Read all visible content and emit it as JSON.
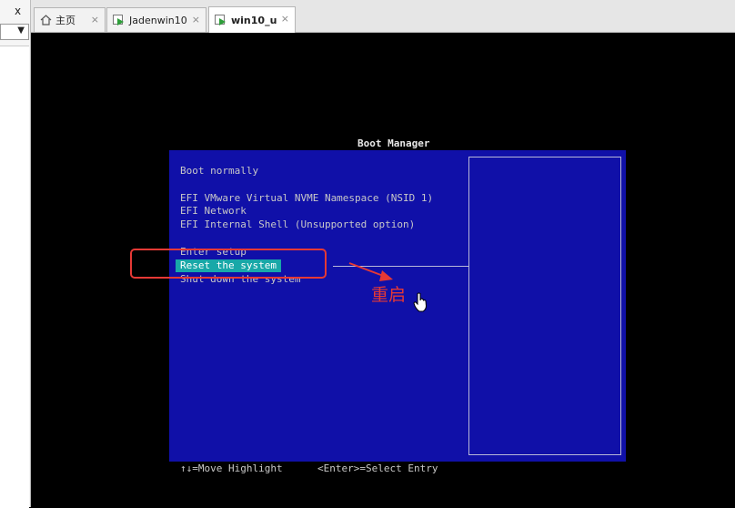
{
  "left_panel": {
    "close_glyph": "x",
    "dropdown_arrow": "▼"
  },
  "tabs": [
    {
      "label": "主页",
      "icon": "home-icon",
      "close": "×",
      "active": false
    },
    {
      "label": "Jadenwin10",
      "icon": "vm-icon",
      "close": "×",
      "active": false
    },
    {
      "label": "win10_u",
      "icon": "vm-icon",
      "close": "×",
      "active": true
    }
  ],
  "boot_manager": {
    "title": "Boot Manager",
    "items": [
      "Boot normally",
      "EFI VMware Virtual NVME Namespace (NSID 1)",
      "EFI Network",
      "EFI Internal Shell (Unsupported option)",
      "Enter setup",
      "Reset the system",
      "Shut down the system"
    ],
    "selected_index": 5,
    "footer_move": "↑↓=Move Highlight",
    "footer_select": "<Enter>=Select Entry"
  },
  "annotation": {
    "label": "重启",
    "color": "#e53935"
  },
  "colors": {
    "panel_blue": "#1010a8",
    "highlight": "#18a8a8"
  }
}
